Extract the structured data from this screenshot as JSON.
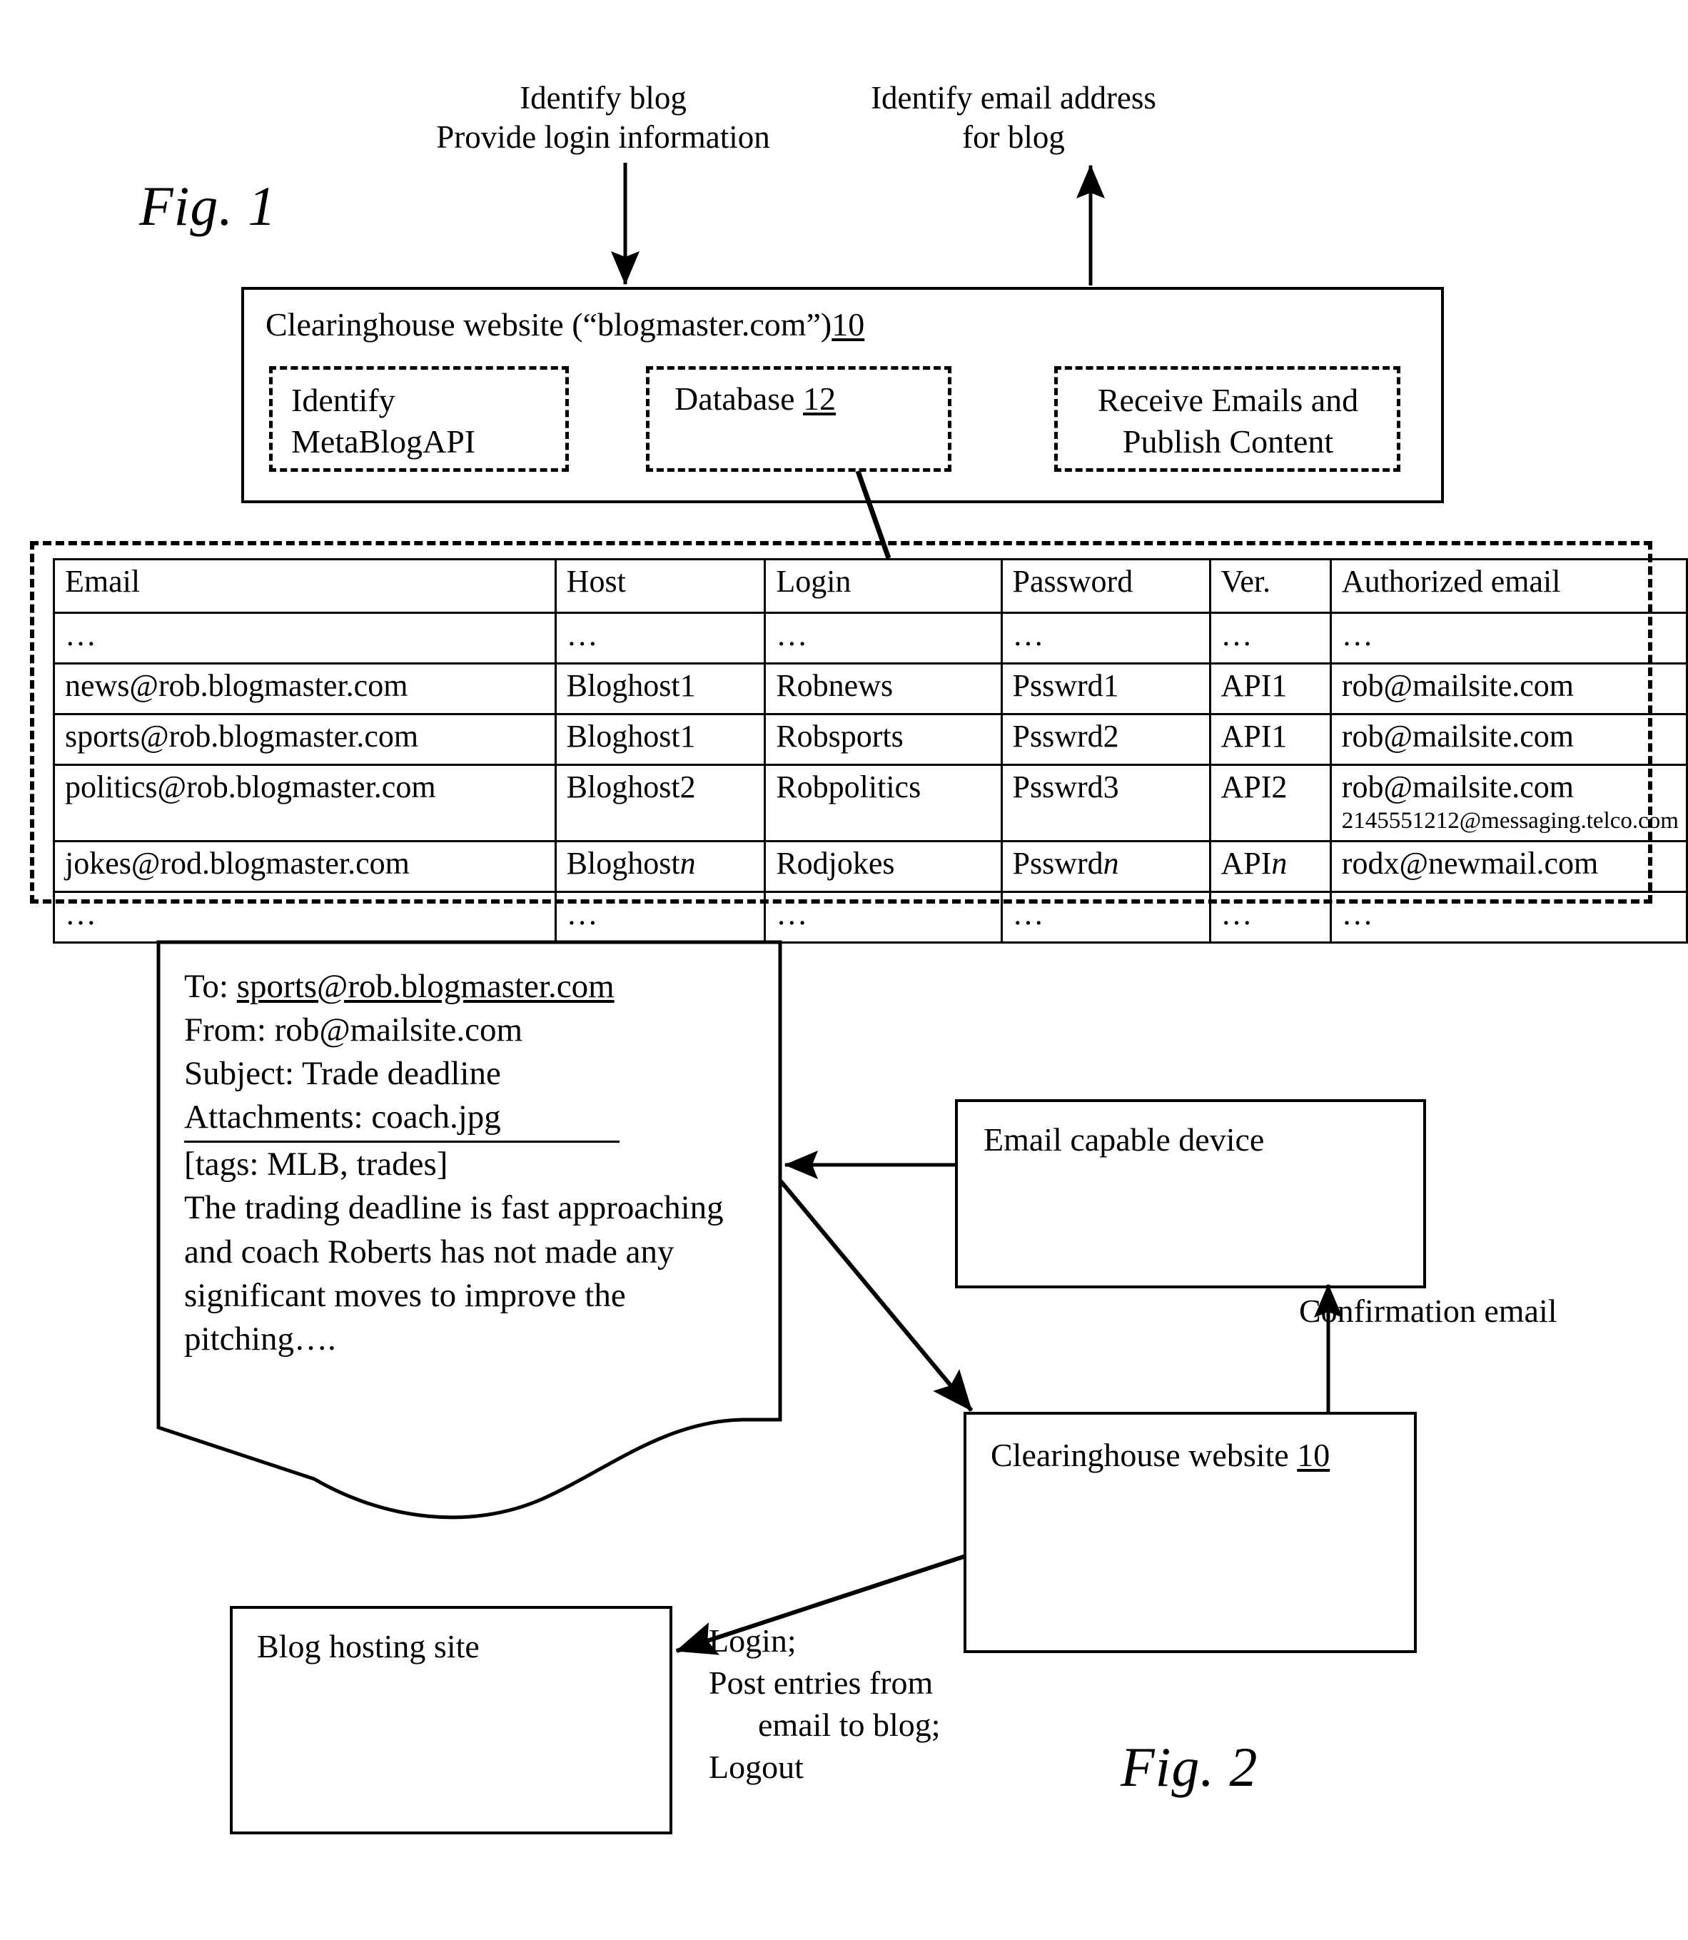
{
  "figures": {
    "fig1_label": "Fig. 1",
    "fig2_label": "Fig. 2"
  },
  "fig1": {
    "callout_left": "Identify blog\nProvide login information",
    "callout_right": "Identify email address\nfor blog",
    "clearinghouse": {
      "title": "Clearinghouse website (“blogmaster.com”)",
      "ref": "10",
      "modules": [
        {
          "label": "Identify\nMetaBlogAPI"
        },
        {
          "label": "Database ",
          "ref": "12"
        },
        {
          "label": "Receive Emails and\nPublish Content"
        }
      ]
    },
    "database_table": {
      "headers": [
        "Email",
        "Host",
        "Login",
        "Password",
        "Ver.",
        "Authorized email"
      ],
      "rows": [
        {
          "email": "…",
          "host": "…",
          "login": "…",
          "password": "…",
          "ver": "…",
          "authorized": "…",
          "authorized2": ""
        },
        {
          "email": "news@rob.blogmaster.com",
          "host": "Bloghost1",
          "login": "Robnews",
          "password": "Psswrd1",
          "ver": "API1",
          "authorized": "rob@mailsite.com",
          "authorized2": ""
        },
        {
          "email": "sports@rob.blogmaster.com",
          "host": "Bloghost1",
          "login": "Robsports",
          "password": "Psswrd2",
          "ver": "API1",
          "authorized": "rob@mailsite.com",
          "authorized2": ""
        },
        {
          "email": "politics@rob.blogmaster.com",
          "host": "Bloghost2",
          "login": "Robpolitics",
          "password": "Psswrd3",
          "ver": "API2",
          "authorized": "rob@mailsite.com",
          "authorized2": "2145551212@messaging.telco.com"
        },
        {
          "email": "jokes@rod.blogmaster.com",
          "host": "Bloghost",
          "host_ital": "n",
          "login": "Rodjokes",
          "password": "Psswrd",
          "password_ital": "n",
          "ver": "API",
          "ver_ital": "n",
          "authorized": "rodx@newmail.com",
          "authorized2": ""
        },
        {
          "email": "…",
          "host": "…",
          "login": "…",
          "password": "…",
          "ver": "…",
          "authorized": "…",
          "authorized2": ""
        }
      ]
    }
  },
  "fig2": {
    "email_message": {
      "to_label": "To: ",
      "to_value": "sports@rob.blogmaster.com",
      "from_label": "From: ",
      "from_value": "rob@mailsite.com",
      "subject_label": "Subject: ",
      "subject_value": "Trade deadline",
      "attachments_label": "Attachments: ",
      "attachments_value": "coach.jpg",
      "tags": "[tags: MLB, trades]",
      "body": "The trading deadline is fast approaching and coach Roberts has not made any significant moves to improve the pitching…."
    },
    "email_device_box": {
      "label": "Email capable device"
    },
    "clearinghouse_box": {
      "label": "Clearinghouse website ",
      "ref": "10"
    },
    "blog_host_box": {
      "label": "Blog hosting site"
    },
    "arrow_labels": {
      "confirmation_email": "Confirmation email",
      "login_post_logout": "Login;\nPost entries from\n      email to blog;\nLogout"
    }
  },
  "colors": {
    "ink": "#000000",
    "paper": "#ffffff"
  }
}
